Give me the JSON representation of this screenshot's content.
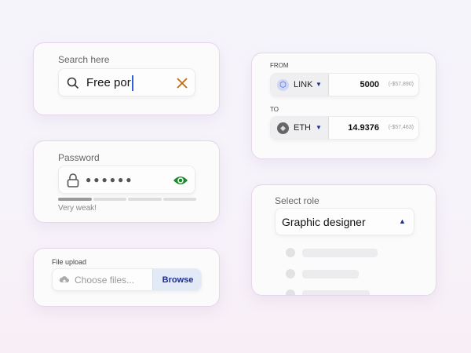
{
  "search": {
    "label": "Search here",
    "value": "Free por"
  },
  "password": {
    "label": "Password",
    "mask": "●●●●●●",
    "strength_text": "Very weak!",
    "strength_level": 0.25
  },
  "file_upload": {
    "label": "File upload",
    "placeholder": "Choose files...",
    "browse_label": "Browse"
  },
  "swap": {
    "from_label": "FROM",
    "from_token": "LINK",
    "from_amount": "5000",
    "from_value": "(-$57,890)",
    "to_label": "TO",
    "to_token": "ETH",
    "to_amount": "14.9376",
    "to_value": "(-$57,463)"
  },
  "role": {
    "label": "Select role",
    "selected": "Graphic designer"
  },
  "colors": {
    "accent": "#1f2d8a",
    "success": "#1a8a2a",
    "clear": "#c26a12"
  }
}
